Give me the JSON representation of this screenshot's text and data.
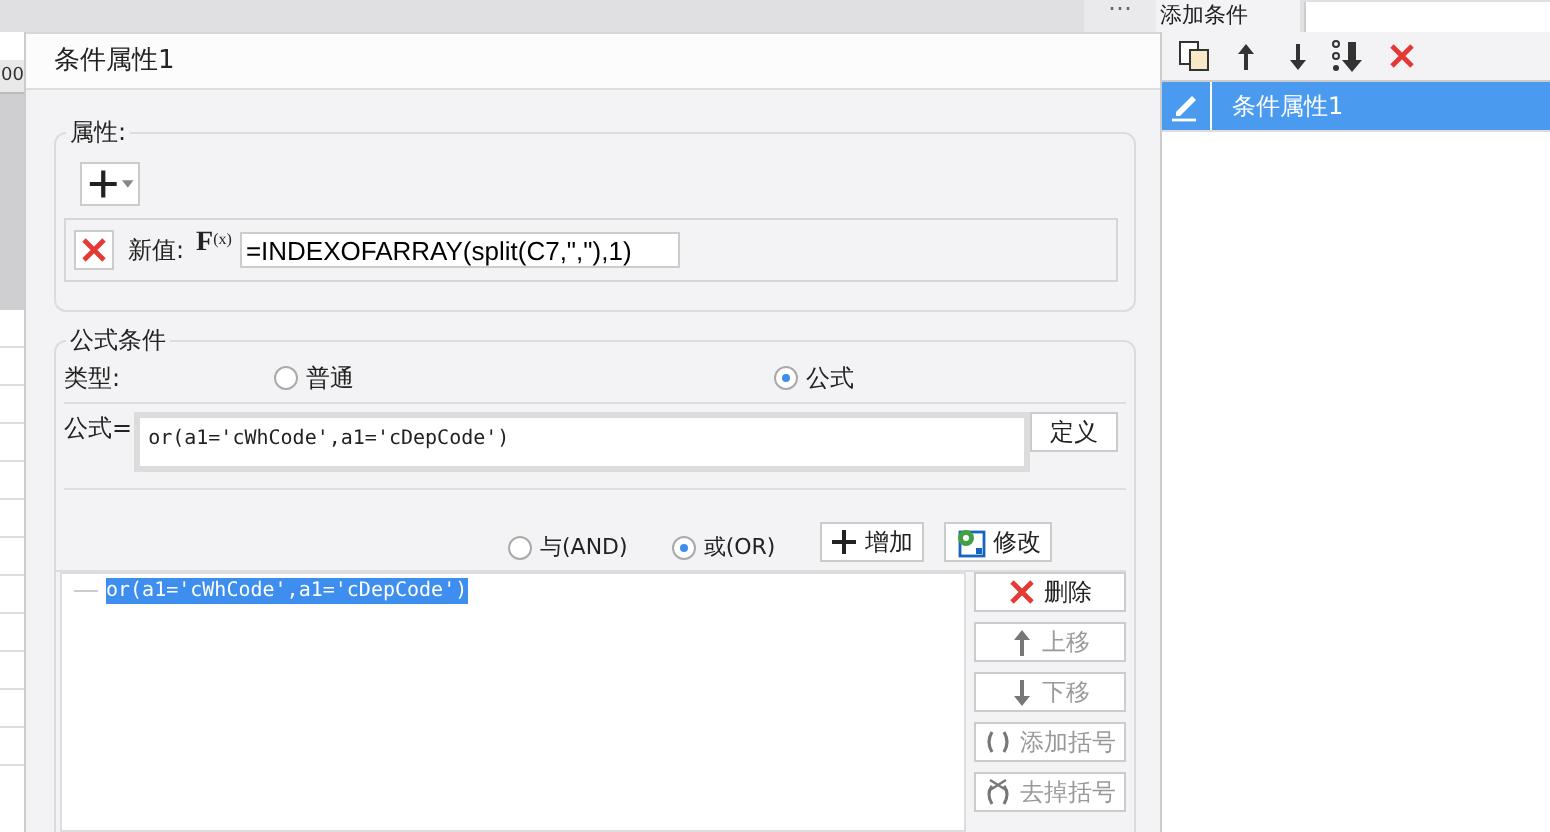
{
  "top_bar": {
    "overflow": "⋯",
    "tab": "添加条件"
  },
  "sheet": {
    "column_header": "00"
  },
  "dialog": {
    "title": "条件属性1",
    "properties": {
      "legend": "属性:",
      "new_value_label": "新值:",
      "function_button": {
        "letter": "F",
        "sub": "(x)"
      },
      "new_value": "=INDEXOFARRAY(split(C7,\",\"),1)"
    },
    "formula_condition": {
      "legend": "公式条件",
      "type_label": "类型:",
      "types": [
        {
          "label": "普通",
          "selected": false
        },
        {
          "label": "公式",
          "selected": true
        }
      ],
      "formula_label": "公式=",
      "formula": "or(a1='cWhCode',a1='cDepCode')",
      "define_button": "定义",
      "logic": [
        {
          "label": "与(AND)",
          "selected": false
        },
        {
          "label": "或(OR)",
          "selected": true
        }
      ],
      "add_button": "增加",
      "edit_button": "修改",
      "conditions": [
        {
          "text": "or(a1='cWhCode',a1='cDepCode')",
          "selected": true
        }
      ],
      "actions": [
        {
          "kind": "delete",
          "label": "删除",
          "disabled": false
        },
        {
          "kind": "up",
          "label": "上移",
          "disabled": true
        },
        {
          "kind": "down",
          "label": "下移",
          "disabled": true
        },
        {
          "kind": "bracket",
          "label": "添加括号",
          "disabled": true
        },
        {
          "kind": "unbracket",
          "label": "去掉括号",
          "disabled": true
        }
      ]
    }
  },
  "panel": {
    "items": [
      {
        "label": "条件属性1",
        "selected": true
      }
    ]
  }
}
